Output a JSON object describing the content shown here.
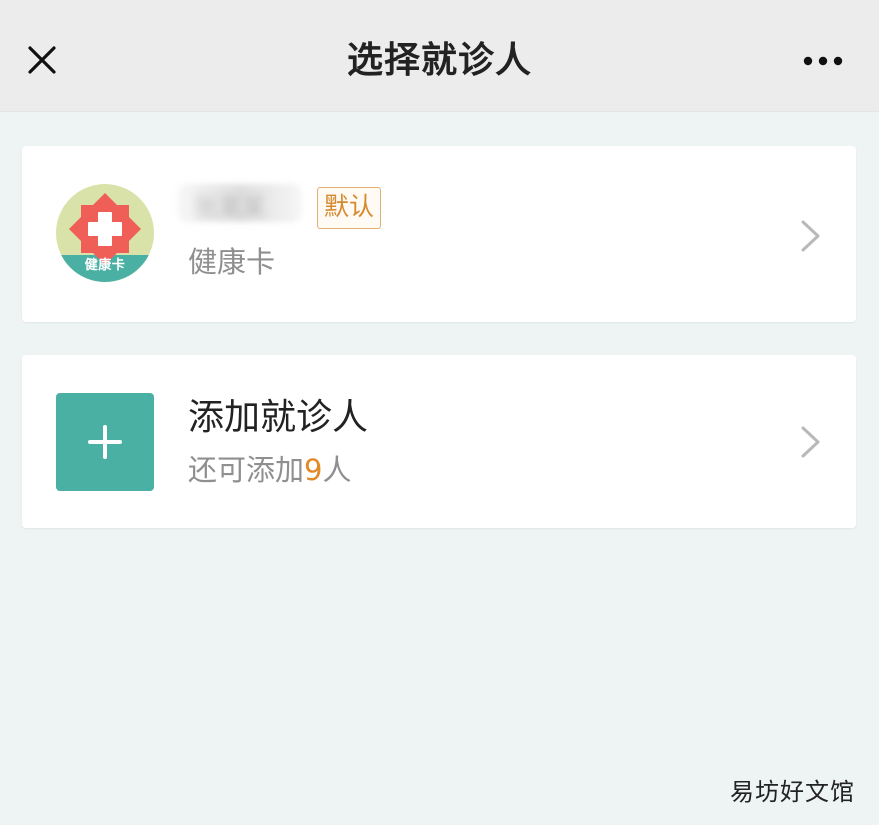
{
  "header": {
    "title": "选择就诊人"
  },
  "patient_card": {
    "name": "张某某",
    "badge": "默认",
    "card_type": "健康卡",
    "avatar_label": "健康卡"
  },
  "add_card": {
    "title": "添加就诊人",
    "sub_prefix": "还可添加",
    "count": "9",
    "sub_suffix": "人"
  },
  "watermark": "易坊好文馆",
  "icons": {
    "close": "close-icon",
    "more": "more-horizontal-icon",
    "chevron": "chevron-right-icon",
    "plus": "plus-icon",
    "health_card": "health-card-icon"
  },
  "colors": {
    "header_bg": "#ececec",
    "page_bg": "#eef4f4",
    "accent_teal": "#4bb0a4",
    "accent_orange": "#e28a27",
    "badge_border": "#e2ae73",
    "avatar_bg": "#d9e3a9",
    "avatar_red": "#ef5f57"
  }
}
